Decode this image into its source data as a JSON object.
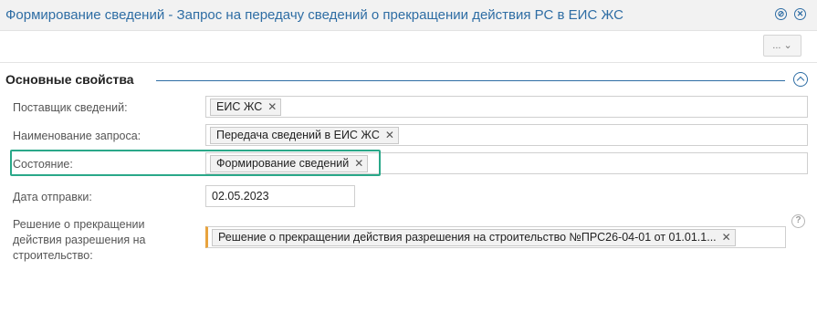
{
  "window": {
    "title": "Формирование сведений - Запрос на передачу сведений о прекращении действия РС в ЕИС ЖС",
    "icons": [
      "settings-icon",
      "close-icon"
    ]
  },
  "toolbar": {
    "more_label": "... ⌄"
  },
  "section": {
    "title": "Основные свойства"
  },
  "fields": {
    "supplier": {
      "label": "Поставщик сведений:",
      "tag": "ЕИС ЖС"
    },
    "request_name": {
      "label": "Наименование запроса:",
      "tag": "Передача сведений в ЕИС ЖС"
    },
    "state": {
      "label": "Состояние:",
      "tag": "Формирование сведений"
    },
    "send_date": {
      "label": "Дата отправки:",
      "value": "02.05.2023"
    },
    "decision": {
      "label": "Решение о прекращении действия разрешения на строительство:",
      "tag": "Решение о прекращении действия разрешения на строительство №ПРС26-04-01 от 01.01.1..."
    }
  },
  "remove_glyph": "✕",
  "help_glyph": "?",
  "colors": {
    "accent": "#2e6da4",
    "highlight": "#2aa889",
    "required": "#e8a33d"
  }
}
